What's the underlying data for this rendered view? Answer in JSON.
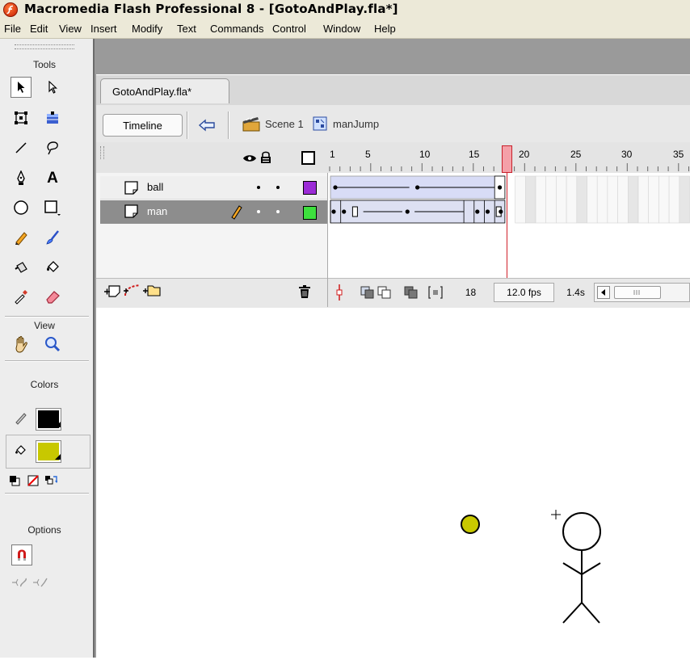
{
  "window": {
    "title": "Macromedia Flash Professional 8 - [GotoAndPlay.fla*]"
  },
  "menu": [
    "File",
    "Edit",
    "View",
    "Insert",
    "Modify",
    "Text",
    "Commands",
    "Control",
    "Window",
    "Help"
  ],
  "tools": {
    "header": "Tools",
    "view_label": "View",
    "colors_label": "Colors",
    "options_label": "Options",
    "stroke_color": "#000000",
    "fill_color": "#c8c800"
  },
  "document": {
    "tab_label": "GotoAndPlay.fla*",
    "timeline_button": "Timeline",
    "breadcrumbs": [
      "Scene 1",
      "manJump"
    ]
  },
  "timeline": {
    "ruler_labels": [
      "1",
      "5",
      "10",
      "15",
      "20",
      "25",
      "30",
      "35"
    ],
    "playhead_frame": 18,
    "layers": [
      {
        "name": "ball",
        "color": "#9b2bd6",
        "selected": false
      },
      {
        "name": "man",
        "color": "#3ee03e",
        "selected": true
      }
    ],
    "current_frame": "18",
    "frame_rate": "12.0 fps",
    "elapsed_time": "1.4s"
  },
  "stage": {
    "ball_color": "#c8c800"
  }
}
